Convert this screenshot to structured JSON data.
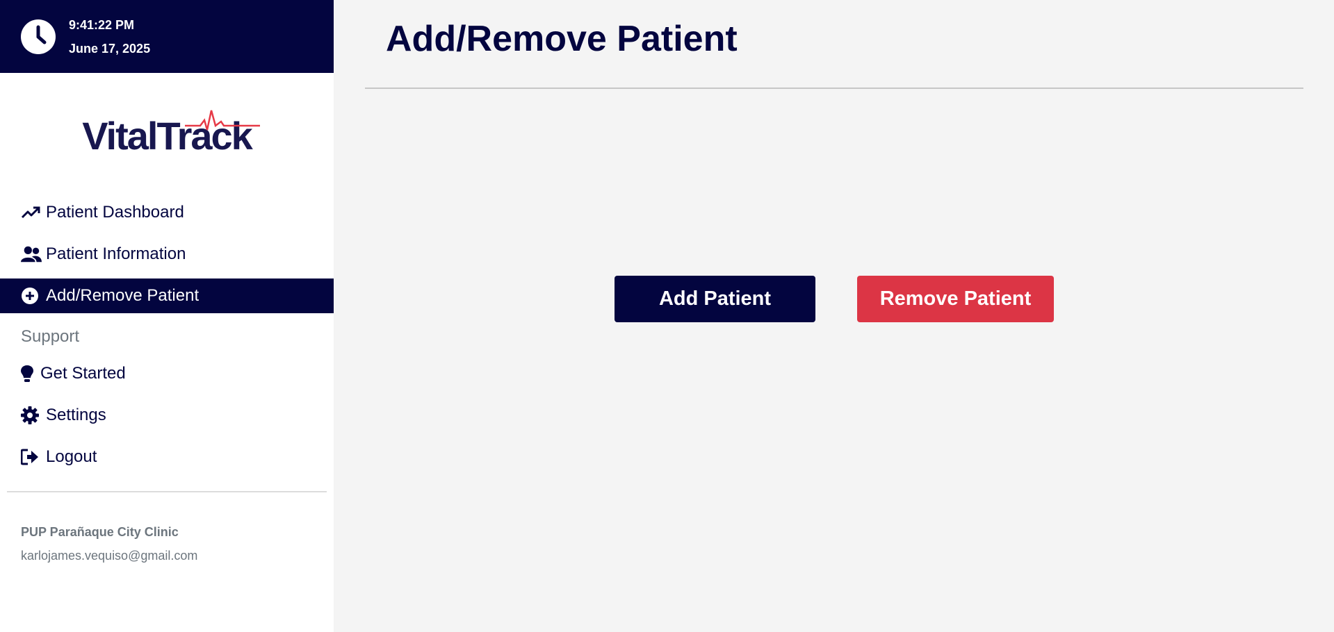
{
  "clock": {
    "time": "9:41:22 PM",
    "date": "June 17, 2025"
  },
  "logo": {
    "text": "VitalTrack"
  },
  "nav": {
    "items": [
      {
        "label": "Patient Dashboard",
        "icon": "trending-up-icon"
      },
      {
        "label": "Patient Information",
        "icon": "users-icon"
      },
      {
        "label": "Add/Remove Patient",
        "icon": "plus-circle-icon",
        "active": true
      }
    ]
  },
  "support": {
    "label": "Support",
    "items": [
      {
        "label": "Get Started",
        "icon": "lightbulb-icon"
      },
      {
        "label": "Settings",
        "icon": "gear-icon"
      },
      {
        "label": "Logout",
        "icon": "logout-icon"
      }
    ]
  },
  "footer": {
    "clinic": "PUP Parañaque City Clinic",
    "email": "karlojames.vequiso@gmail.com"
  },
  "main": {
    "title": "Add/Remove Patient",
    "add_label": "Add Patient",
    "remove_label": "Remove Patient"
  },
  "colors": {
    "primary": "#03053f",
    "danger": "#dc3545",
    "muted": "#6c757d",
    "background": "#f4f4f4",
    "logo_pulse": "#e63946"
  }
}
